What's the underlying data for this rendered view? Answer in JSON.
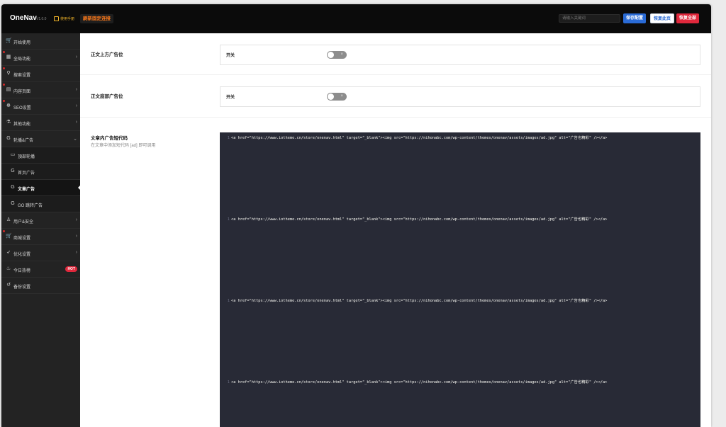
{
  "header": {
    "logo": "OneNav",
    "version": "V1.0.0",
    "manual_label": "使用手册",
    "update_label": "刷新固定连接",
    "search_placeholder": "请输入关键词",
    "save_label": "保存配置",
    "restore_page_label": "恢复此页",
    "restore_all_label": "恢复全部"
  },
  "sidebar": {
    "items": [
      {
        "label": "开始使用",
        "icon": "cart-icon",
        "arrow": false
      },
      {
        "label": "全局功能",
        "icon": "grid-icon",
        "arrow": true
      },
      {
        "label": "搜索设置",
        "icon": "search-icon",
        "arrow": false
      },
      {
        "label": "内容页面",
        "icon": "document-icon",
        "arrow": true
      },
      {
        "label": "SEO设置",
        "icon": "seo-icon",
        "arrow": true
      },
      {
        "label": "其他功能",
        "icon": "flask-icon",
        "arrow": true
      },
      {
        "label": "轮播&广告",
        "icon": "google-icon",
        "arrow": true
      },
      {
        "label": "頂部轮播",
        "icon": "monitor-icon",
        "arrow": false
      },
      {
        "label": "首页广告",
        "icon": "google-icon",
        "arrow": false
      },
      {
        "label": "文章广告",
        "icon": "google-icon",
        "arrow": false
      },
      {
        "label": "GO 跳转广告",
        "icon": "google-icon",
        "arrow": false
      },
      {
        "label": "用户&安全",
        "icon": "user-icon",
        "arrow": true
      },
      {
        "label": "商城设置",
        "icon": "cart-icon",
        "arrow": true
      },
      {
        "label": "优化设置",
        "icon": "rocket-icon",
        "arrow": true
      },
      {
        "label": "今日热榜",
        "icon": "fire-icon",
        "arrow": false,
        "badge": "HOT"
      },
      {
        "label": "备份设置",
        "icon": "undo-icon",
        "arrow": false
      }
    ]
  },
  "main": {
    "section1": {
      "title": "正文上方广告位",
      "switch_label": "开关",
      "switch_state": "off"
    },
    "section2": {
      "title": "正文底部广告位",
      "switch_label": "开关",
      "switch_state": "off"
    },
    "section3": {
      "title": "文章内广告短代码",
      "desc": "在文章中添加短代码 [ad] 即可调用",
      "code_lines": [
        {
          "num": "1",
          "text": "<a href=\"https://www.iotheme.cn/store/onenav.html\" target=\"_blank\"><img src=\"https://nihonabc.com/wp-content/themes/onenav/assets/images/ad.jpg\" alt=\"广告也精彩\" /></a>"
        },
        {
          "num": "1",
          "text": "<a href=\"https://www.iotheme.cn/store/onenav.html\" target=\"_blank\"><img src=\"https://nihonabc.com/wp-content/themes/onenav/assets/images/ad.jpg\" alt=\"广告也精彩\" /></a>"
        },
        {
          "num": "1",
          "text": "<a href=\"https://www.iotheme.cn/store/onenav.html\" target=\"_blank\"><img src=\"https://nihonabc.com/wp-content/themes/onenav/assets/images/ad.jpg\" alt=\"广告也精彩\" /></a>"
        },
        {
          "num": "1",
          "text": "<a href=\"https://www.iotheme.cn/store/onenav.html\" target=\"_blank\"><img src=\"https://nihonabc.com/wp-content/themes/onenav/assets/images/ad.jpg\" alt=\"广告也精彩\" /></a>"
        }
      ]
    }
  },
  "colors": {
    "header_bg": "#0b0b0b",
    "sidebar_bg": "#232323",
    "accent_blue": "#2a6bd6",
    "accent_red": "#e0283c",
    "update_orange": "#ff7a1a",
    "code_bg": "#282a36"
  }
}
